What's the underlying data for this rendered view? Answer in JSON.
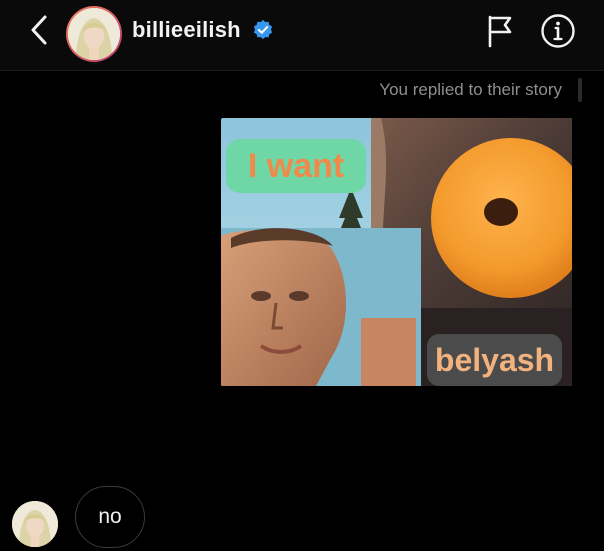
{
  "header": {
    "username": "billieeilish",
    "verified": true,
    "accent": "#3897f0"
  },
  "icons": {
    "back": "chevron-left-icon",
    "flag": "flag-icon",
    "info": "info-icon",
    "verified": "verified-badge-icon"
  },
  "conversation": {
    "reply_note": "You replied to their story",
    "story": {
      "text_top": "I want",
      "text_bottom": "belyash"
    },
    "incoming_message": "no"
  }
}
